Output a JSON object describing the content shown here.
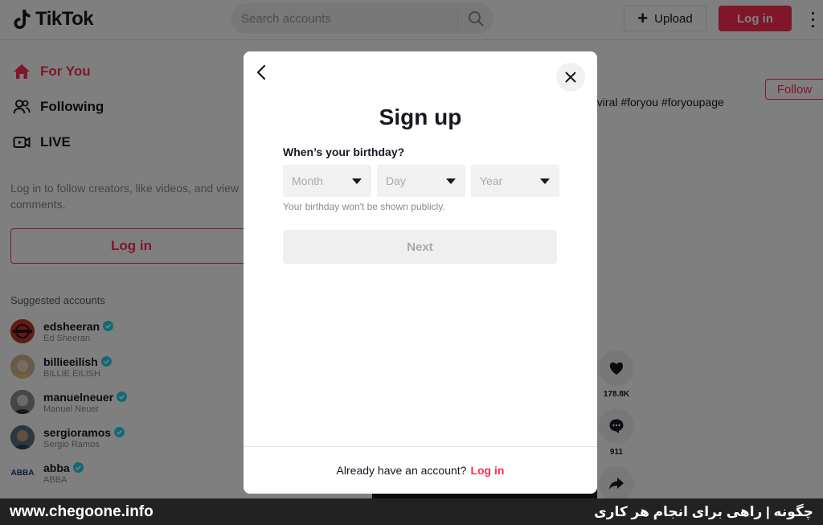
{
  "header": {
    "logo_text": "TikTok",
    "search_placeholder": "Search accounts",
    "upload_label": "Upload",
    "login_label": "Log in"
  },
  "sidebar": {
    "nav": [
      {
        "label": "For You",
        "icon": "home-icon",
        "active": true
      },
      {
        "label": "Following",
        "icon": "users-icon",
        "active": false
      },
      {
        "label": "LIVE",
        "icon": "live-icon",
        "active": false
      }
    ],
    "login_hint": "Log in to follow creators, like videos, and view comments.",
    "login_label": "Log in",
    "suggested_title": "Suggested accounts",
    "accounts": [
      {
        "username": "edsheeran",
        "name": "Ed Sheeran"
      },
      {
        "username": "billieeilish",
        "name": "BILLIE EILISH"
      },
      {
        "username": "manuelneuer",
        "name": "Manuel Neuer"
      },
      {
        "username": "sergioramos",
        "name": "Sergio Ramos"
      },
      {
        "username": "abba",
        "name": "ABBA",
        "avatar_text": "ABBA"
      }
    ]
  },
  "feed": {
    "follow_label": "Follow",
    "hashtags": "#viral #foryou #foryoupage",
    "likes_count": "178.8K",
    "comments_count": "911"
  },
  "modal": {
    "title": "Sign up",
    "birthday_label": "When’s your birthday?",
    "month_placeholder": "Month",
    "day_placeholder": "Day",
    "year_placeholder": "Year",
    "hint": "Your birthday won't be shown publicly.",
    "next_label": "Next",
    "footer_text": "Already have an account?",
    "footer_login": "Log in"
  },
  "banner": {
    "left": "www.chegoone.info",
    "right": "چگونه | راهی برای انجام هر کاری"
  },
  "colors": {
    "brand": "#fe2c55",
    "verified": "#20d5ec"
  }
}
